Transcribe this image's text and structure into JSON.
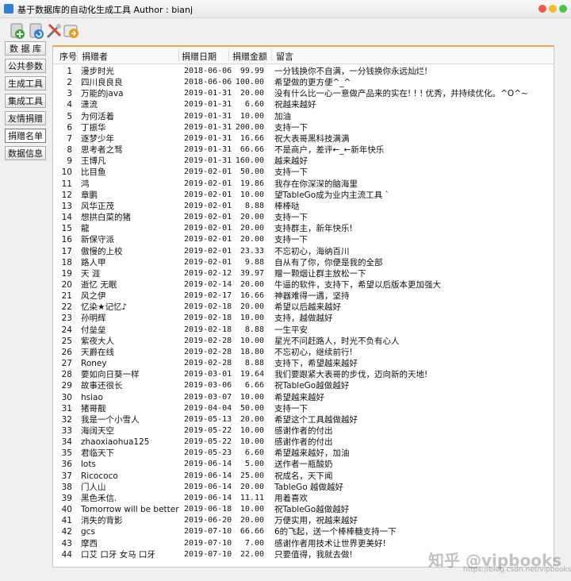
{
  "window": {
    "title": "基于数据库的自动化生成工具 Author : bianj"
  },
  "toolbar": {
    "icons": [
      "add-db-icon",
      "refresh-db-icon",
      "tools-icon",
      "export-icon"
    ]
  },
  "sidebar": {
    "items": [
      {
        "label": "数 据 库"
      },
      {
        "label": "公共参数"
      },
      {
        "label": "生成工具"
      },
      {
        "label": "集成工具"
      },
      {
        "label": "友情捐赠"
      },
      {
        "label": "捐赠名单"
      },
      {
        "label": "数据信息"
      }
    ],
    "active_index": 5
  },
  "table": {
    "columns": [
      "序号",
      "捐赠者",
      "捐赠日期",
      "捐赠金额",
      "留言"
    ],
    "rows": [
      [
        "1",
        "漫步时光",
        "2018-06-06",
        "99.99",
        "一分钱换你不自满，一分钱换你永远灿烂!"
      ],
      [
        "2",
        "四川良良良",
        "2018-06-06",
        "100.00",
        "希望做的更方便^_^"
      ],
      [
        "3",
        "万能的java",
        "2019-01-31",
        "20.00",
        "没有什么比一心一意做产品来的实在! ! ! 优秀，并持续优化。^O^~"
      ],
      [
        "4",
        "潇流",
        "2019-01-31",
        "6.60",
        "祝越来越好"
      ],
      [
        "5",
        "为何活着",
        "2019-01-31",
        "10.00",
        "加油"
      ],
      [
        "6",
        "丁振华",
        "2019-01-31",
        "200.00",
        "支持一下"
      ],
      [
        "7",
        "逐梦少年",
        "2019-01-31",
        "16.66",
        "祝大表哥黑科技满满"
      ],
      [
        "8",
        "思考者之驽",
        "2019-01-31",
        "66.66",
        "不是商户，差评←_←新年快乐"
      ],
      [
        "9",
        "王博凡",
        "2019-01-31",
        "160.00",
        "越来越好"
      ],
      [
        "10",
        "比目鱼",
        "2019-02-01",
        "50.00",
        "支持一下"
      ],
      [
        "11",
        "鸿",
        "2019-02-01",
        "19.86",
        "我存在你深深的脑海里"
      ],
      [
        "12",
        "章鹏",
        "2019-02-01",
        "10.00",
        "望TableGo成为业内主流工具 `"
      ],
      [
        "13",
        "风华正茂",
        "2019-02-01",
        "8.88",
        "棒棒哒"
      ],
      [
        "14",
        "想拱白菜的猪",
        "2019-02-01",
        "20.00",
        "支持一下"
      ],
      [
        "15",
        "龍",
        "2019-02-01",
        "20.00",
        "支持群主，新年快乐!"
      ],
      [
        "16",
        "新保守派",
        "2019-02-01",
        "20.00",
        "支持一下"
      ],
      [
        "17",
        "傲慢的上校",
        "2019-02-01",
        "23.33",
        "不忘初心，海纳百川"
      ],
      [
        "18",
        "路人甲",
        "2019-02-01",
        "9.88",
        "自从有了你，你便是我的全部"
      ],
      [
        "19",
        "天 涯",
        "2019-02-12",
        "39.97",
        "赠一颗烟让群主放松一下"
      ],
      [
        "20",
        "逝忆 无眠",
        "2019-02-14",
        "20.00",
        "牛逼的软件，支持下，希望以后版本更加强大"
      ],
      [
        "21",
        "风之伊",
        "2019-02-17",
        "16.66",
        "神器难得一遇，坚持"
      ],
      [
        "22",
        "忆染★记忆♪",
        "2019-02-18",
        "20.00",
        "希望以后越来越好"
      ],
      [
        "23",
        "孙明辉",
        "2019-02-18",
        "10.00",
        "支持，越做越好"
      ],
      [
        "24",
        "付垒垒",
        "2019-02-18",
        "8.88",
        "一生平安"
      ],
      [
        "25",
        "紫夜大人",
        "2019-02-28",
        "10.00",
        "星光不问赶路人，时光不负有心人"
      ],
      [
        "26",
        "天爵在线",
        "2019-02-28",
        "18.80",
        "不忘初心，继续前行!"
      ],
      [
        "27",
        "Roney",
        "2019-02-28",
        "8.88",
        "支持下，希望越来越好"
      ],
      [
        "28",
        "要如向日葵一样",
        "2019-03-01",
        "19.64",
        "我们要跟紧大表哥的步伐，迈向新的天地!"
      ],
      [
        "29",
        "故事还很长",
        "2019-03-06",
        "6.66",
        "祝TableGo越做越好"
      ],
      [
        "30",
        "hsiao",
        "2019-03-07",
        "10.00",
        "希望越来越好"
      ],
      [
        "31",
        "猪哥靓",
        "2019-04-04",
        "50.00",
        "支持一下"
      ],
      [
        "32",
        "我是一个小雪人",
        "2019-05-13",
        "20.00",
        "希望这个工具越做越好"
      ],
      [
        "33",
        "海阔天空",
        "2019-05-22",
        "10.00",
        "感谢作者的付出"
      ],
      [
        "34",
        "zhaoxiaohua125",
        "2019-05-22",
        "10.00",
        "感谢作者的付出"
      ],
      [
        "35",
        "君临天下",
        "2019-05-23",
        "6.60",
        "希望越来越好，加油"
      ],
      [
        "36",
        "lots",
        "2019-06-14",
        "5.00",
        "送作者一瓶酸奶"
      ],
      [
        "37",
        "Ricococo",
        "2019-06-14",
        "25.00",
        "祝成名，天下闻"
      ],
      [
        "38",
        "门人山",
        "2019-06-14",
        "20.00",
        "TableGo 越做越好"
      ],
      [
        "39",
        "黑色禾信.",
        "2019-06-14",
        "11.11",
        "用着喜欢"
      ],
      [
        "40",
        "Tomorrow will be better",
        "2019-06-18",
        "10.00",
        "祝TableGo越做越好"
      ],
      [
        "41",
        "消失的背影",
        "2019-06-20",
        "20.00",
        "万便实用，祝越来越好"
      ],
      [
        "42",
        "gcs",
        "2019-07-10",
        "66.66",
        "6的飞起，送一个棒棒糖支持一下"
      ],
      [
        "43",
        "摩西",
        "2019-07-10",
        "7.00",
        "感谢作者用技术让世界更美好!"
      ],
      [
        "44",
        "口艾 口牙 女马 口牙",
        "2019-07-10",
        "22.00",
        "只要值得，我就去做!"
      ]
    ]
  },
  "watermark": {
    "main": "知乎 @vipbooks",
    "sub": "https://blog.csdn.net/vipbooks"
  },
  "colors": {
    "accent": "#e5a84a",
    "close": "#f15a4a",
    "minimize": "#f7b731",
    "maximize": "#4cc34a"
  }
}
